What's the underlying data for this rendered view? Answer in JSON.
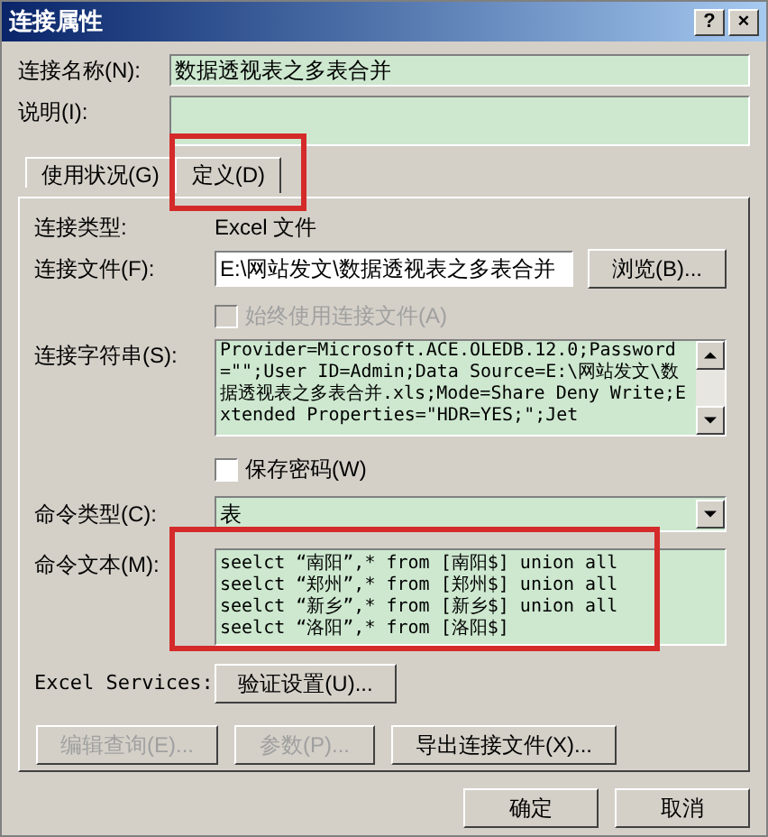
{
  "window": {
    "title": "连接属性",
    "title_buttons": [
      "?",
      "×"
    ]
  },
  "connection_name": {
    "label": "连接名称(N):",
    "value": "数据透视表之多表合并"
  },
  "description": {
    "label": "说明(I):"
  },
  "tabs": [
    {
      "label": "使用状况(G)",
      "selected": false,
      "highlighted": false
    },
    {
      "label": "定义(D)",
      "selected": true,
      "highlighted": true
    }
  ],
  "definition": {
    "connection_type": {
      "label": "连接类型:",
      "value": "Excel 文件"
    },
    "connection_file": {
      "label": "连接文件(F):",
      "value": "E:\\网站发文\\数据透视表之多表合并",
      "button": "浏览(B)..."
    },
    "always_use_file": {
      "label": "始终使用连接文件(A)",
      "checked": false,
      "disabled": true
    },
    "connection_string": {
      "label": "连接字符串(S):",
      "value": "Provider=Microsoft.ACE.OLEDB.12.0;Password=\"\";User ID=Admin;Data Source=E:\\网站发文\\数据透视表之多表合并.xls;Mode=Share Deny Write;Extended Properties=\"HDR=YES;\";Jet"
    },
    "save_password": {
      "label": "保存密码(W)",
      "checked": false,
      "disabled": false
    },
    "command_type": {
      "label": "命令类型(C):",
      "value": "表"
    },
    "command_text": {
      "label": "命令文本(M):",
      "value": "seelct “南阳”,* from [南阳$] union all\nseelct “郑州”,* from [郑州$] union all\nseelct “新乡”,* from [新乡$] union all\nseelct “洛阳”,* from [洛阳$]",
      "highlighted": true
    },
    "excel_services": {
      "label": "Excel Services:",
      "button": "验证设置(U)..."
    },
    "buttons": [
      {
        "label": "编辑查询(E)...",
        "disabled": true
      },
      {
        "label": "参数(P)...",
        "disabled": true
      },
      {
        "label": "导出连接文件(X)...",
        "disabled": false
      }
    ]
  },
  "footer_buttons": [
    "确定",
    "取消"
  ]
}
